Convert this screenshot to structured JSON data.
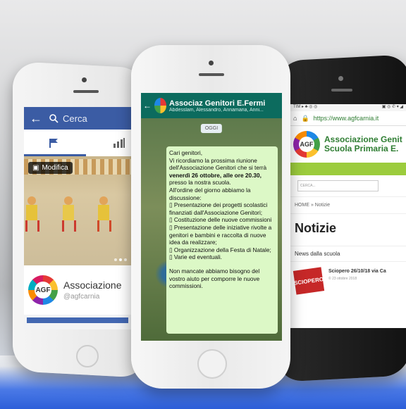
{
  "facebook": {
    "search_label": "Cerca",
    "edit_label": "Modifica",
    "page_name": "Associazione",
    "handle": "@agfcarnia",
    "logo_text": "AGF"
  },
  "whatsapp": {
    "group_name": "Associaz Genitori E.Fermi",
    "members": "Abdesslam, Alessandro, Annamaria, Anni...",
    "date_chip": "OGGI",
    "message_lines": [
      "Cari genitori,",
      "Vi ricordiamo la prossima riunione dell'Associazione Genitori che si terrà",
      "venerdì 26 ottobre, alle ore 20.30,",
      "presso la nostra scuola.",
      "All'ordine del giorno abbiamo la discussione:",
      "▯ Presentazione dei progetti scolastici finanziati dall'Associazione Genitori;",
      "▯ Costituzione delle nuove commissioni",
      "▯ Presentazione delle iniziative rivolte a genitori e bambini e raccolta di nuove idea da realizzare;",
      "▯ Organizzazione della Festa di Natale;",
      "▯ Varie ed eventuali.",
      "",
      "Non mancate abbiamo bisogno del vostro aiuto per comporre le nuove commissioni."
    ]
  },
  "website": {
    "url": "https://www.agfcarnia.it",
    "logo_text": "AGF",
    "title_line1": "Associazione Genit",
    "title_line2": "Scuola Primaria E.",
    "search_placeholder": "CERCA...",
    "breadcrumb": "HOME  »  Notizie",
    "heading": "Notizie",
    "section": "News dalla scuola",
    "news_title": "Sciopero 26/10/18 via Ca",
    "news_date": "© 23 ottobre 2018",
    "news_thumb": "SCIOPERO"
  }
}
